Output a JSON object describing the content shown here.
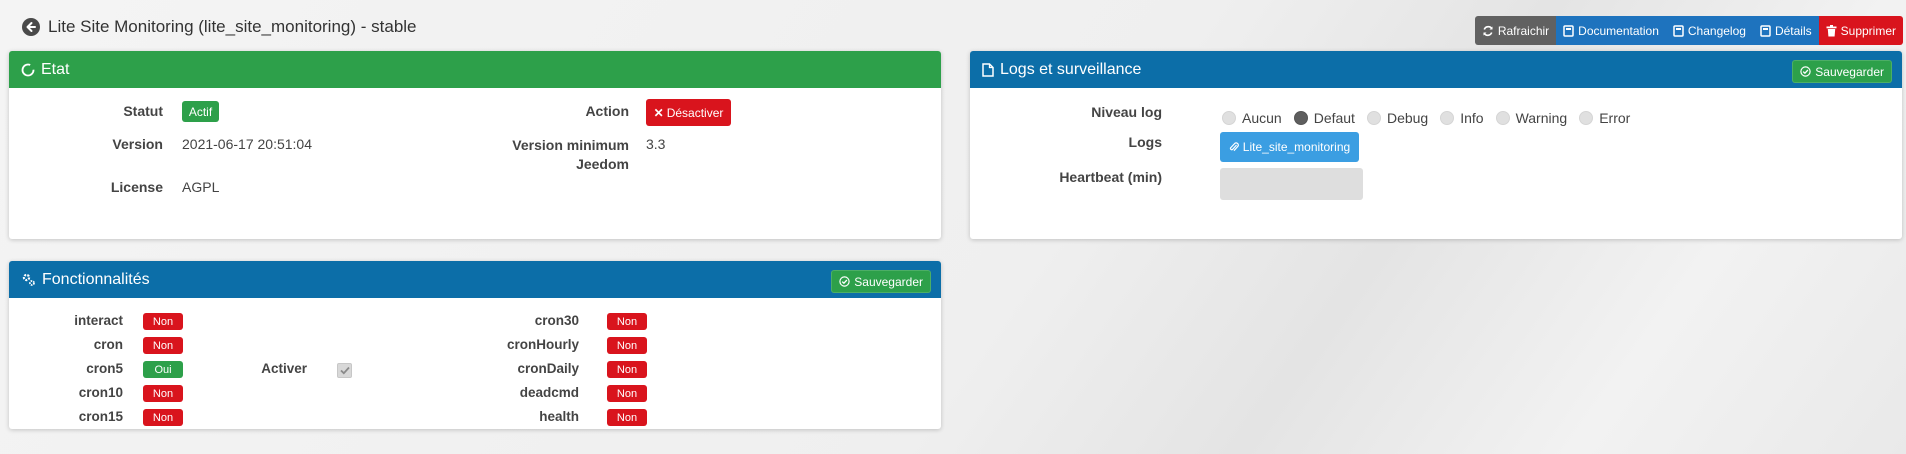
{
  "page": {
    "title": "Lite Site Monitoring (lite_site_monitoring) - stable"
  },
  "toolbar": {
    "refresh_label": "Rafraichir",
    "documentation_label": "Documentation",
    "changelog_label": "Changelog",
    "details_label": "Détails",
    "delete_label": "Supprimer"
  },
  "etat": {
    "title": "Etat",
    "statut_label": "Statut",
    "statut_value": "Actif",
    "version_label": "Version",
    "version_value": "2021-06-17 20:51:04",
    "license_label": "License",
    "license_value": "AGPL",
    "action_label": "Action",
    "action_button": "Désactiver",
    "min_version_label_1": "Version minimum",
    "min_version_label_2": "Jeedom",
    "min_version_value": "3.3"
  },
  "logs": {
    "title": "Logs et surveillance",
    "save_label": "Sauvegarder",
    "niveau_label": "Niveau log",
    "levels": [
      "Aucun",
      "Defaut",
      "Debug",
      "Info",
      "Warning",
      "Error"
    ],
    "selected_level": "Defaut",
    "logs_label": "Logs",
    "logs_button": "Lite_site_monitoring",
    "heartbeat_label": "Heartbeat (min)",
    "heartbeat_value": ""
  },
  "fonctionnalites": {
    "title": "Fonctionnalités",
    "save_label": "Sauvegarder",
    "left": [
      {
        "name": "interact",
        "value": "Non"
      },
      {
        "name": "cron",
        "value": "Non"
      },
      {
        "name": "cron5",
        "value": "Oui"
      },
      {
        "name": "cron10",
        "value": "Non"
      },
      {
        "name": "cron15",
        "value": "Non"
      }
    ],
    "activer_label": "Activer",
    "activer_checked": true,
    "right": [
      {
        "name": "cron30",
        "value": "Non"
      },
      {
        "name": "cronHourly",
        "value": "Non"
      },
      {
        "name": "cronDaily",
        "value": "Non"
      },
      {
        "name": "deadcmd",
        "value": "Non"
      },
      {
        "name": "health",
        "value": "Non"
      }
    ]
  },
  "colors": {
    "green": "#2da04a",
    "blue": "#0c6ea8",
    "red": "#d9141d",
    "toolbar_blue": "#1e73be",
    "logs_button": "#3b9ee2"
  }
}
